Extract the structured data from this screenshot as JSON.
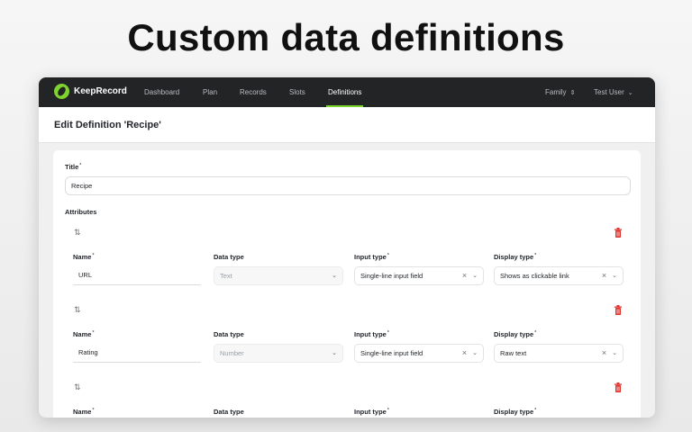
{
  "hero": {
    "title": "Custom data definitions"
  },
  "navbar": {
    "logo_text": "KeepRecord",
    "links": [
      {
        "label": "Dashboard"
      },
      {
        "label": "Plan"
      },
      {
        "label": "Records"
      },
      {
        "label": "Slots"
      },
      {
        "label": "Definitions",
        "active": true
      }
    ],
    "family_label": "Family",
    "user_label": "Test User",
    "accent_color": "#7fd32f"
  },
  "page": {
    "title": "Edit Definition 'Recipe'"
  },
  "form": {
    "title_label": "Title",
    "title_value": "Recipe",
    "attributes_label": "Attributes",
    "attributes": [
      {
        "name_label": "Name",
        "name_value": "URL",
        "data_type_label": "Data type",
        "data_type_value": "Text",
        "input_type_label": "Input type",
        "input_type_value": "Single-line input field",
        "display_type_label": "Display type",
        "display_type_value": "Shows as clickable link"
      },
      {
        "name_label": "Name",
        "name_value": "Rating",
        "data_type_label": "Data type",
        "data_type_value": "Number",
        "input_type_label": "Input type",
        "input_type_value": "Single-line input field",
        "display_type_label": "Display type",
        "display_type_value": "Raw text"
      },
      {
        "name_label": "Name",
        "data_type_label": "Data type",
        "input_type_label": "Input type",
        "display_type_label": "Display type"
      }
    ]
  },
  "icons": {
    "reorder": "sort-arrows-icon",
    "delete": "trash-icon",
    "clear": "close-icon",
    "dropdown": "chevron-down-icon",
    "required_mark": "*"
  }
}
